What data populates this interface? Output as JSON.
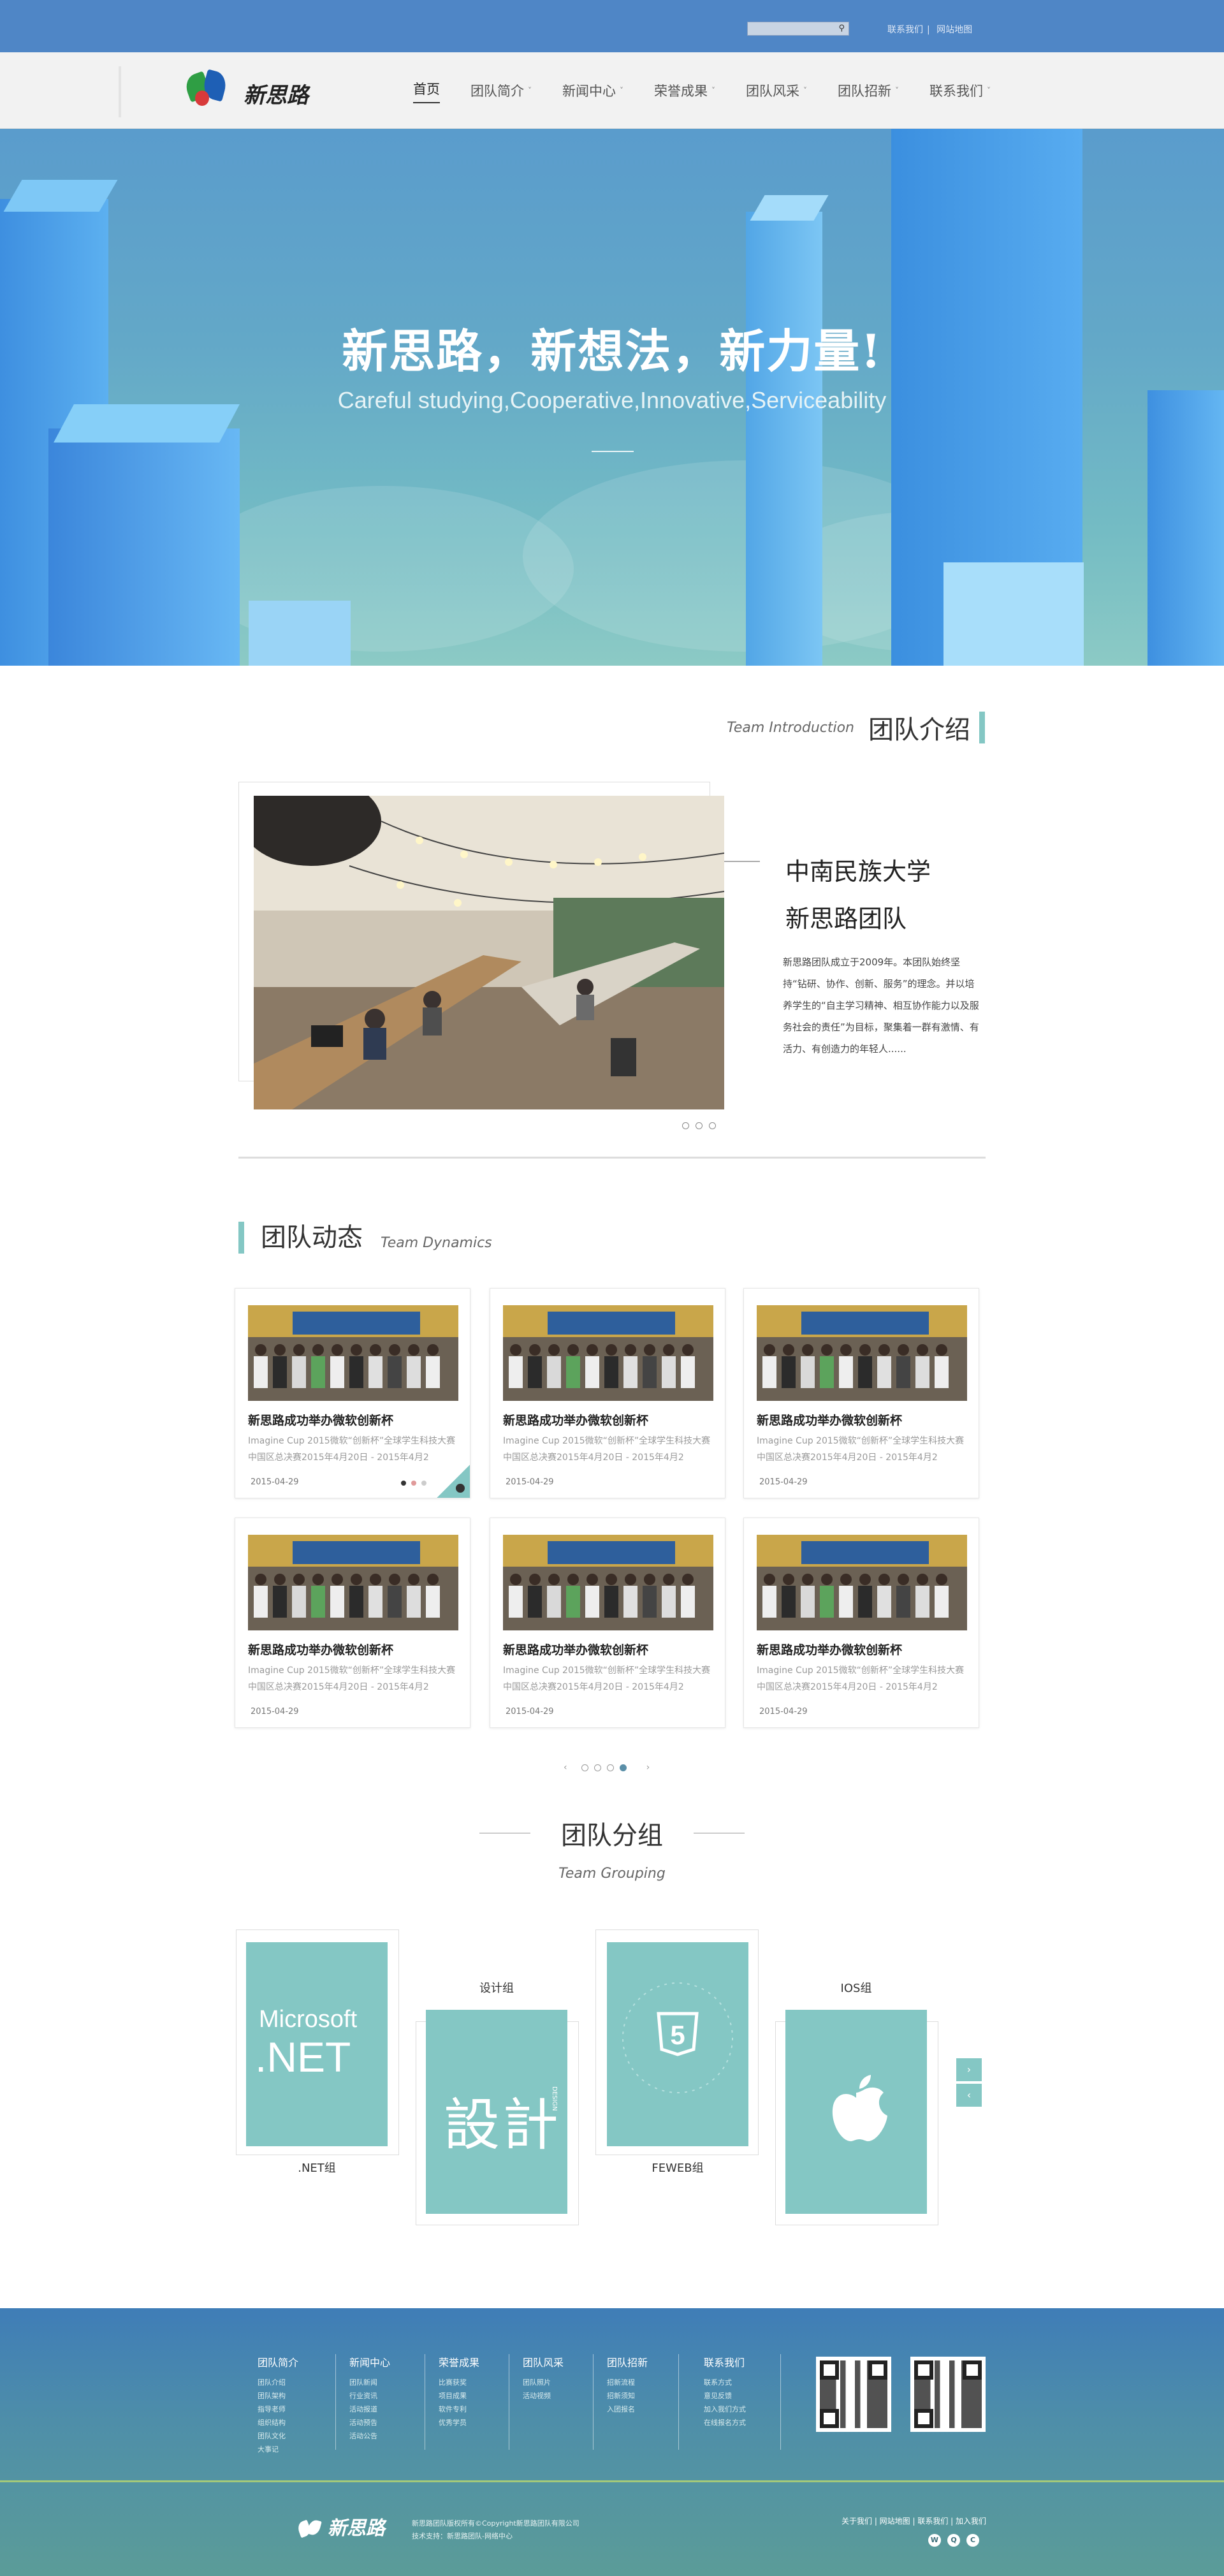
{
  "topbar": {
    "search_icon": "search-icon",
    "links": [
      "联系我们",
      "网站地图"
    ]
  },
  "nav": {
    "logo_text": "新思路",
    "items": [
      {
        "label": "首页",
        "active": true,
        "has_caret": false
      },
      {
        "label": "团队简介",
        "has_caret": true
      },
      {
        "label": "新闻中心",
        "has_caret": true
      },
      {
        "label": "荣誉成果",
        "has_caret": true
      },
      {
        "label": "团队风采",
        "has_caret": true
      },
      {
        "label": "团队招新",
        "has_caret": true
      },
      {
        "label": "联系我们",
        "has_caret": true
      }
    ],
    "caret": "˅"
  },
  "hero": {
    "title": "新思路，新想法，新力量!",
    "subtitle": "Careful studying,Cooperative,Innovative,Serviceability"
  },
  "intro": {
    "heading_en": "Team Introduction",
    "heading_cn": "团队介绍",
    "title_line1": "中南民族大学",
    "title_line2": "新思路团队",
    "text": "新思路团队成立于2009年。本团队始终坚持“钻研、协作、创新、服务”的理念。并以培养学生的“自主学习精神、相互协作能力以及服务社会的责任”为目标，聚集着一群有激情、有活力、有创造力的年轻人......"
  },
  "dynamics": {
    "heading_cn": "团队动态",
    "heading_en": "Team Dynamics",
    "card_title": "新思路成功举办微软创新杯",
    "card_desc": "Imagine Cup 2015微软“创新杯”全球学生科技大赛中国区总决赛2015年4月20日 - 2015年4月2",
    "card_date": "2015-04-29",
    "pager_prev": "‹",
    "pager_next": "›"
  },
  "grouping": {
    "heading_cn": "团队分组",
    "heading_en": "Team Grouping",
    "groups": [
      {
        "label": ".NET组",
        "tile_text1": "Microsoft",
        "tile_text2": ".NET"
      },
      {
        "label": "设计组",
        "tile_text1": "設計",
        "tile_text2": "DESIGN"
      },
      {
        "label": "FEWEB组",
        "tile_text1": "5",
        "tile_text2": ""
      },
      {
        "label": "IOS组",
        "tile_text1": "",
        "tile_text2": ""
      }
    ],
    "arrow_up": "›",
    "arrow_down": "‹"
  },
  "footer": {
    "columns": [
      {
        "title": "团队简介",
        "items": [
          "团队介绍",
          "团队架构",
          "指导老师",
          "组织结构",
          "团队文化",
          "大事记"
        ]
      },
      {
        "title": "新闻中心",
        "items": [
          "团队新闻",
          "行业资讯",
          "活动报道",
          "活动预告",
          "活动公告"
        ]
      },
      {
        "title": "荣誉成果",
        "items": [
          "比赛获奖",
          "项目成果",
          "软件专利",
          "优秀学员"
        ]
      },
      {
        "title": "团队风采",
        "items": [
          "团队照片",
          "活动视频"
        ]
      },
      {
        "title": "团队招新",
        "items": [
          "招新流程",
          "招新须知",
          "入团报名"
        ]
      },
      {
        "title": "联系我们",
        "items": [
          "联系方式",
          "意见反馈",
          "加入我们方式",
          "在线报名方式"
        ]
      }
    ],
    "logo_text": "新思路",
    "copyright_line1": "新思路团队版权所有©Copyright新思路团队有限公司",
    "copyright_line2": "技术支持：新思路团队-网络中心",
    "links": "关于我们 | 网站地图 | 联系我们 | 加入我们"
  }
}
